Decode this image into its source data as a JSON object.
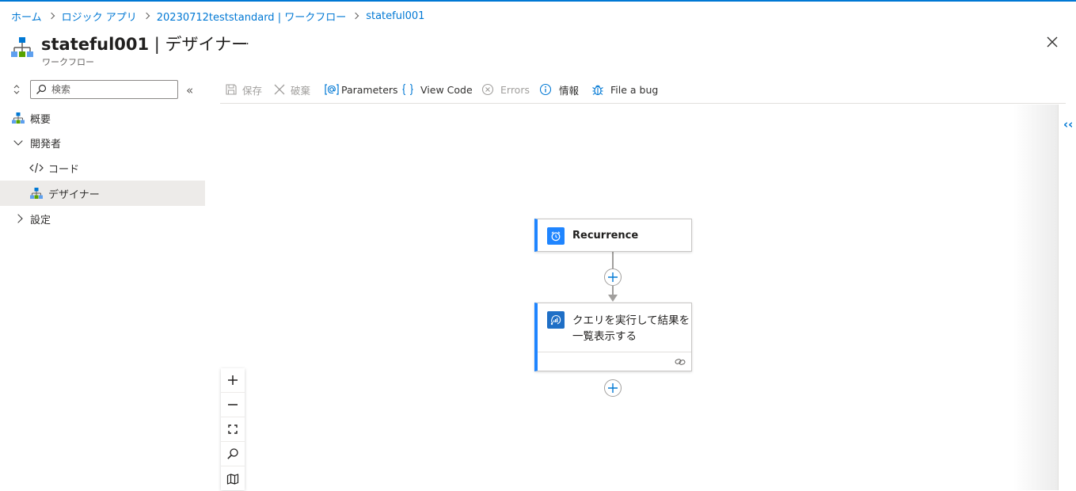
{
  "breadcrumb": {
    "items": [
      "ホーム",
      "ロジック アプリ",
      "20230712teststandard | ワークフロー",
      "stateful001"
    ]
  },
  "header": {
    "title_main": "stateful001",
    "title_rest": " | デザイナー",
    "subtitle": "ワークフロー",
    "more": "…",
    "icon": "workflow-icon"
  },
  "sidebar": {
    "search_placeholder": "検索",
    "collapse": "«",
    "items": [
      {
        "label": "概要",
        "icon": "workflow-icon"
      },
      {
        "label": "開発者",
        "icon": "chevron-down-icon"
      },
      {
        "label": "コード",
        "icon": "code-icon"
      },
      {
        "label": "デザイナー",
        "icon": "workflow-icon",
        "selected": true
      },
      {
        "label": "設定",
        "icon": "chevron-right-icon"
      }
    ]
  },
  "toolbar": {
    "save": "保存",
    "discard": "破棄",
    "parameters": "Parameters",
    "view_code": "View Code",
    "errors": "Errors",
    "info": "情報",
    "file_bug": "File a bug"
  },
  "canvas": {
    "expand": "‹‹",
    "nodes": [
      {
        "title": "Recurrence",
        "icon": "clock-icon"
      },
      {
        "title": "クエリを実行して結果を一覧表示する",
        "icon": "cosmos-icon"
      }
    ]
  },
  "colors": {
    "accent": "#0078d4",
    "node_border": "#1f85ff",
    "selected_bg": "#edebe9"
  }
}
